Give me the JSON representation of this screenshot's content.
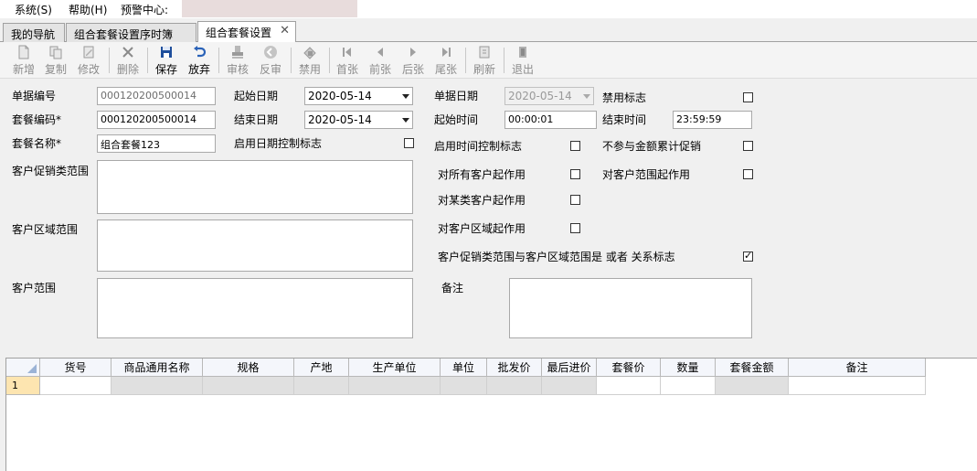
{
  "menu": {
    "system": "系统(S)",
    "help": "帮助(H)",
    "alert_center": "预警中心:"
  },
  "tabs": [
    {
      "label": "我的导航"
    },
    {
      "label": "组合套餐设置序时簿"
    },
    {
      "label": "组合套餐设置"
    }
  ],
  "toolbar": {
    "new": "新增",
    "copy": "复制",
    "edit": "修改",
    "delete": "删除",
    "save": "保存",
    "abandon": "放弃",
    "audit": "审核",
    "unaudit": "反审",
    "disable": "禁用",
    "first": "首张",
    "prev": "前张",
    "next": "后张",
    "last": "尾张",
    "refresh": "刷新",
    "exit": "退出"
  },
  "form": {
    "doc_no_label": "单据编号",
    "doc_no_value": "000120200500014",
    "pkg_code_label": "套餐编码*",
    "pkg_code_value": "000120200500014",
    "pkg_name_label": "套餐名称*",
    "pkg_name_value": "组合套餐123",
    "start_date_label": "起始日期",
    "start_date_value": "2020-05-14",
    "end_date_label": "结束日期",
    "end_date_value": "2020-05-14",
    "date_ctrl_label": "启用日期控制标志",
    "doc_date_label": "单据日期",
    "doc_date_value": "2020-05-14",
    "start_time_label": "起始时间",
    "start_time_value": "00:00:01",
    "end_time_label": "结束时间",
    "end_time_value": "23:59:59",
    "disable_flag_label": "禁用标志",
    "time_ctrl_label": "启用时间控制标志",
    "exclude_amount_label": "不参与金额累计促销",
    "all_customers_label": "对所有客户起作用",
    "customer_range_flag_label": "对客户范围起作用",
    "customer_type_label": "对某类客户起作用",
    "customer_region_label": "对客户区域起作用",
    "relation_flag_label": "客户促销类范围与客户区域范围是 或者 关系标志",
    "promo_range_label": "客户促销类范围",
    "region_range_label": "客户区域范围",
    "customer_range_label": "客户范围",
    "remark_label": "备注"
  },
  "grid": {
    "columns": [
      "货号",
      "商品通用名称",
      "规格",
      "产地",
      "生产单位",
      "单位",
      "批发价",
      "最后进价",
      "套餐价",
      "数量",
      "套餐金额",
      "备注"
    ],
    "row_number": "1"
  }
}
